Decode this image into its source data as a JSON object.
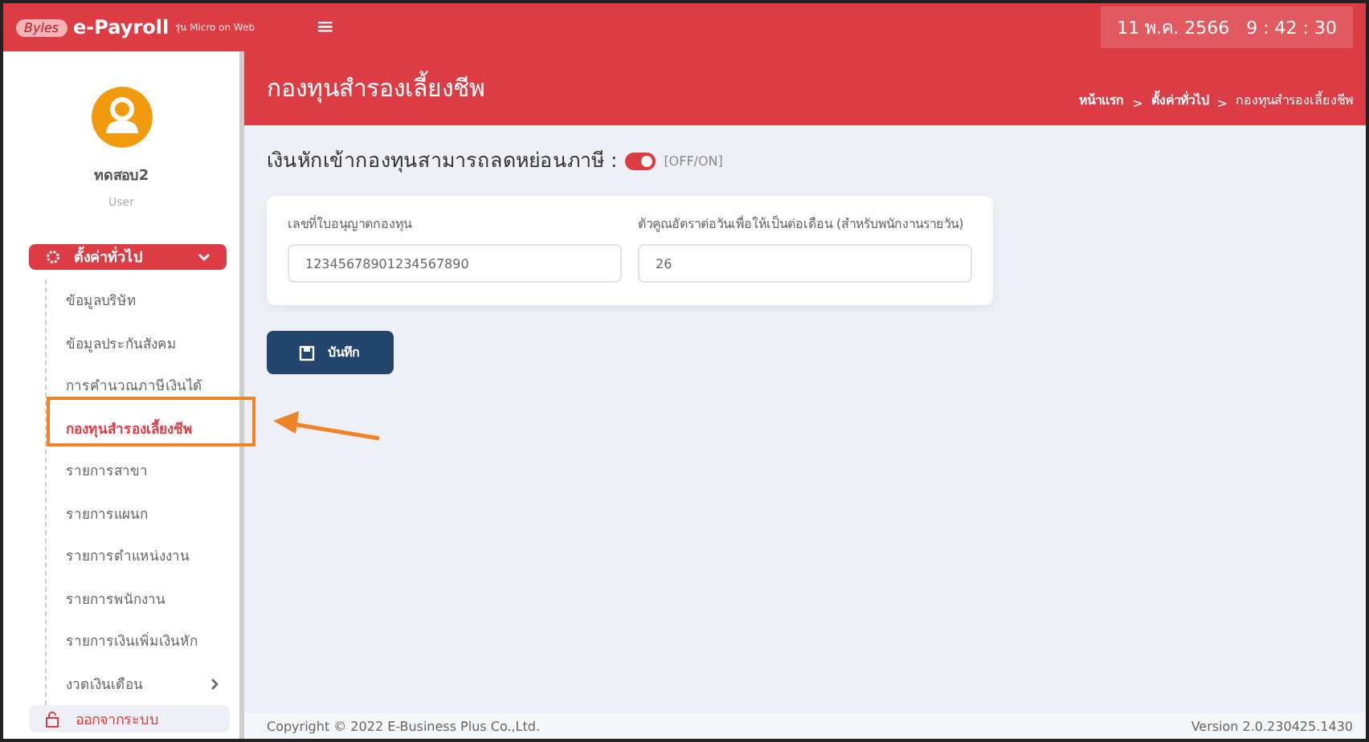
{
  "header": {
    "logo_badge": "Byles",
    "brand": "e-Payroll",
    "edition": "รุ่น Micro on Web",
    "menu_glyph": "≡",
    "clock": "11 พ.ค. 2566   9 : 42 : 30"
  },
  "user": {
    "name": "ทดสอบ2",
    "role": "User"
  },
  "sidebar": {
    "group": {
      "label": "ตั้งค่าทั่วไป",
      "expanded": true
    },
    "items": [
      {
        "label": "ข้อมูลบริษัท",
        "selected": false,
        "kind": "link"
      },
      {
        "label": "ข้อมูลประกันสังคม",
        "selected": false,
        "kind": "link"
      },
      {
        "label": "การคำนวณภาษีเงินได้",
        "selected": false,
        "kind": "link"
      },
      {
        "label": "กองทุนสำรองเลี้ยงชีพ",
        "selected": true,
        "kind": "link"
      },
      {
        "label": "รายการสาขา",
        "selected": false,
        "kind": "link"
      },
      {
        "label": "รายการแผนก",
        "selected": false,
        "kind": "link"
      },
      {
        "label": "รายการตำแหน่งงาน",
        "selected": false,
        "kind": "link"
      },
      {
        "label": "รายการพนักงาน",
        "selected": false,
        "kind": "link"
      },
      {
        "label": "รายการเงินเพิ่มเงินหัก",
        "selected": false,
        "kind": "link"
      },
      {
        "label": "งวดเงินเดือน",
        "selected": false,
        "kind": "submenu"
      }
    ],
    "logout": "ออกจากระบบ"
  },
  "page": {
    "title": "กองทุนสำรองเลี้ยงชีพ",
    "breadcrumb": [
      {
        "label": "หน้าแรก",
        "current": false
      },
      {
        "label": "ตั้งค่าทั่วไป",
        "current": false
      },
      {
        "label": "กองทุนสำรองเลี้ยงชีพ",
        "current": true
      }
    ],
    "separator": ">"
  },
  "toggle": {
    "label": "เงินหักเข้ากองทุนสามารถลดหย่อนภาษี :",
    "on": true,
    "hint": "[OFF/ON]"
  },
  "fields": [
    {
      "label": "เลขที่ใบอนุญาตกองทุน",
      "value": "12345678901234567890"
    },
    {
      "label": "ตัวคูณอัตราต่อวันเพื่อให้เป็นต่อเดือน (สำหรับพนักงานรายวัน)",
      "value": "26"
    }
  ],
  "save_button": "บันทึก",
  "footer": {
    "copyright": "Copyright © 2022 E-Business Plus Co.,Ltd.",
    "version": "Version 2.0.230425.1430"
  }
}
